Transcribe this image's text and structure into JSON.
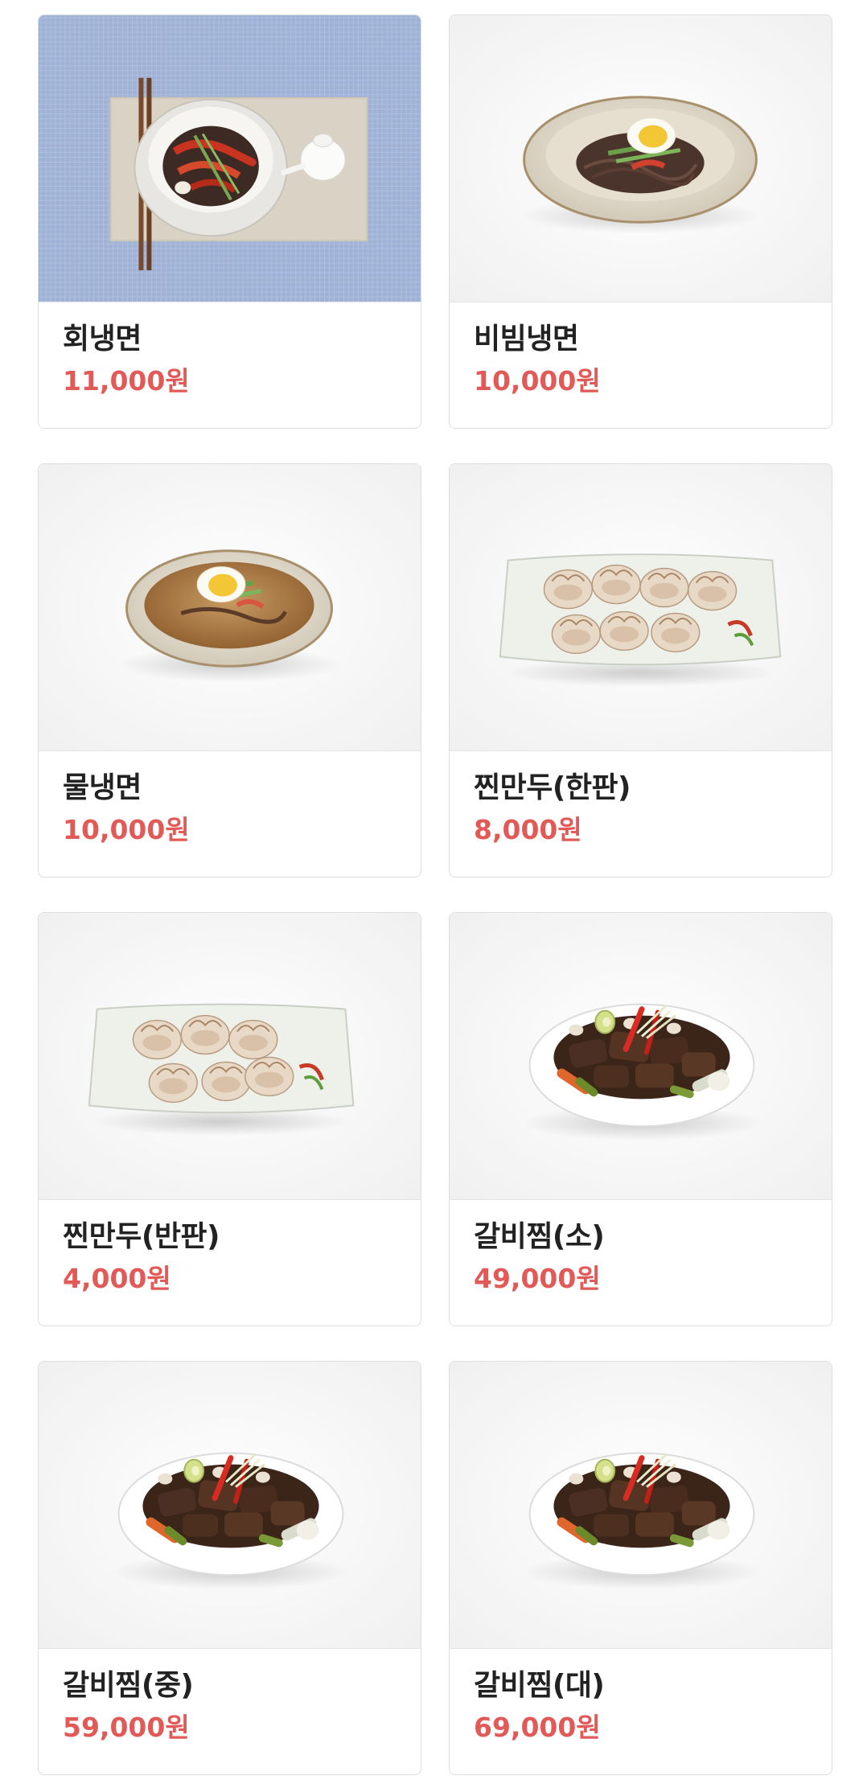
{
  "menu": {
    "items": [
      {
        "name": "회냉면",
        "price": "11,000원",
        "photo": "hoe-naengmyeon-photo"
      },
      {
        "name": "비빔냉면",
        "price": "10,000원",
        "photo": "bibim-naengmyeon-photo"
      },
      {
        "name": "물냉면",
        "price": "10,000원",
        "photo": "mul-naengmyeon-photo"
      },
      {
        "name": "찐만두(한판)",
        "price": "8,000원",
        "photo": "dumplings-full-photo"
      },
      {
        "name": "찐만두(반판)",
        "price": "4,000원",
        "photo": "dumplings-half-photo"
      },
      {
        "name": "갈비찜(소)",
        "price": "49,000원",
        "photo": "galbijjim-photo"
      },
      {
        "name": "갈비찜(중)",
        "price": "59,000원",
        "photo": "galbijjim-photo"
      },
      {
        "name": "갈비찜(대)",
        "price": "69,000원",
        "photo": "galbijjim-photo"
      }
    ]
  },
  "colors": {
    "price": "#e25a57",
    "name": "#222222",
    "card_border": "#dedede"
  }
}
